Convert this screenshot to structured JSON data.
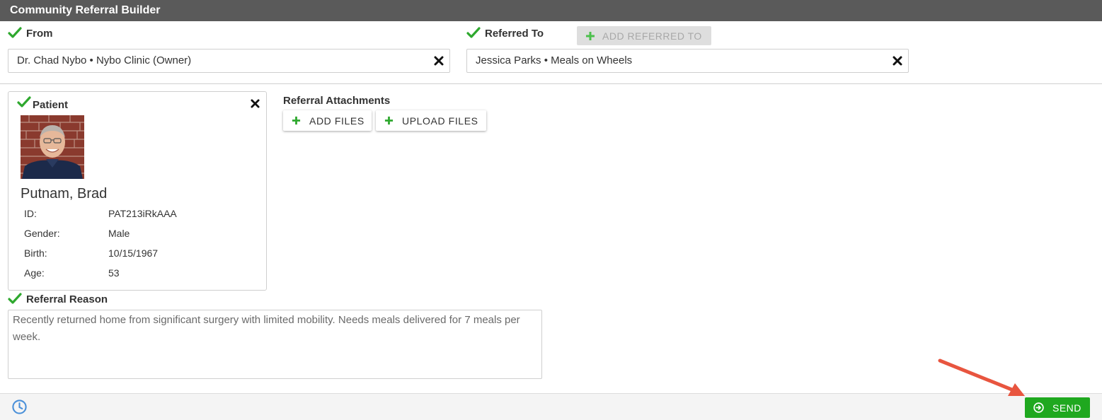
{
  "window": {
    "title": "Community Referral Builder"
  },
  "from": {
    "label": "From",
    "value": "Dr. Chad Nybo • Nybo Clinic (Owner)"
  },
  "referred_to": {
    "label": "Referred To",
    "add_label": "ADD REFERRED TO",
    "value": "Jessica Parks • Meals on Wheels"
  },
  "patient": {
    "label": "Patient",
    "name": "Putnam, Brad",
    "fields": [
      {
        "label": "ID:",
        "value": "PAT213iRkAAA"
      },
      {
        "label": "Gender:",
        "value": "Male"
      },
      {
        "label": "Birth:",
        "value": "10/15/1967"
      },
      {
        "label": "Age:",
        "value": "53"
      }
    ]
  },
  "attachments": {
    "label": "Referral Attachments",
    "add_files_label": "ADD FILES",
    "upload_files_label": "UPLOAD FILES"
  },
  "referral_reason": {
    "label": "Referral Reason",
    "text": "Recently returned home from significant surgery with limited mobility.  Needs meals delivered for 7 meals per week."
  },
  "footer": {
    "send_label": "SEND"
  },
  "colors": {
    "title_bar": "#5a5a5a",
    "check": "#2ea82e",
    "send": "#1fa81f",
    "clock": "#4a90d9",
    "arrow": "#e8553f"
  },
  "icons": [
    "check-icon",
    "close-icon",
    "plus-icon",
    "clock-icon",
    "send-circle-arrow-icon"
  ]
}
